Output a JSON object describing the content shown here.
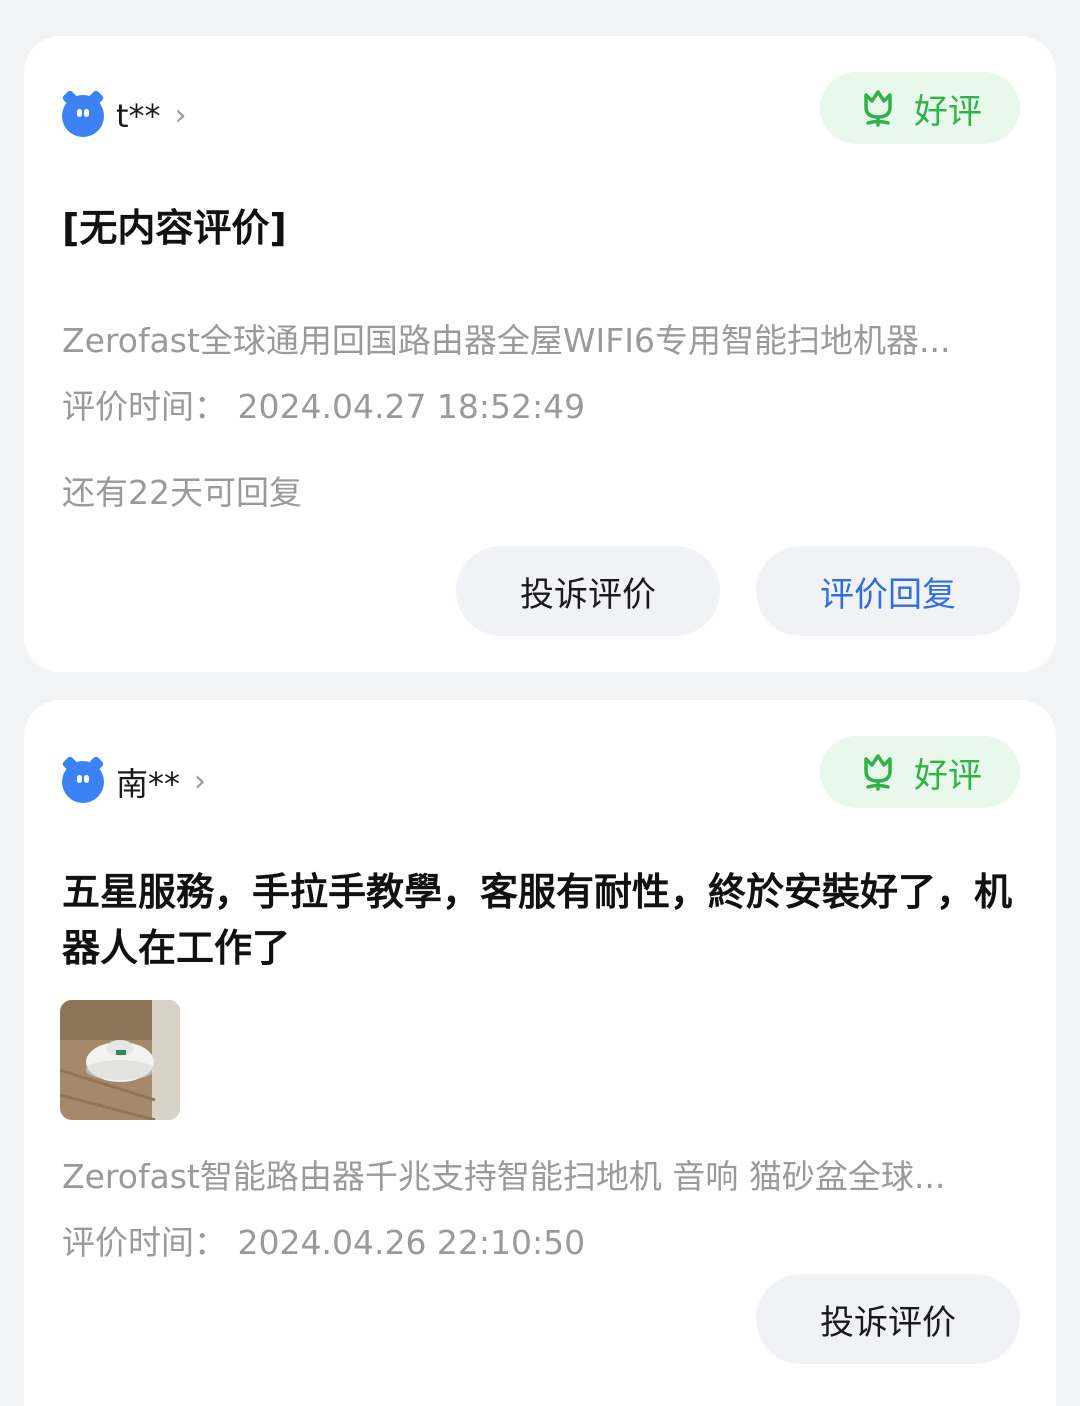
{
  "reviews": [
    {
      "username": "t**",
      "badge": "好评",
      "content": "[无内容评价]",
      "product": "Zerofast全球通用回国路由器全屋WIFI6专用智能扫地机器...",
      "time": "评价时间：  2024.04.27 18:52:49",
      "reply_remaining": "还有22天可回复",
      "complain_button": "投诉评价",
      "reply_button": "评价回复"
    },
    {
      "username": "南**",
      "badge": "好评",
      "content": "五星服務，手拉手教學，客服有耐性，終於安裝好了，机器人在工作了",
      "product": "Zerofast智能路由器千兆支持智能扫地机 音响 猫砂盆全球...",
      "time": "评价时间：  2024.04.26 22:10:50",
      "complain_button": "投诉评价"
    }
  ],
  "icons": {
    "avatar": "blue-cat-avatar-icon",
    "chevron": "chevron-right-icon",
    "badge": "tulip-icon"
  },
  "colors": {
    "badge_bg": "#e8f8ea",
    "badge_text": "#2fb24a",
    "reply_text": "#2f6fe0",
    "avatar": "#3b82f6"
  }
}
